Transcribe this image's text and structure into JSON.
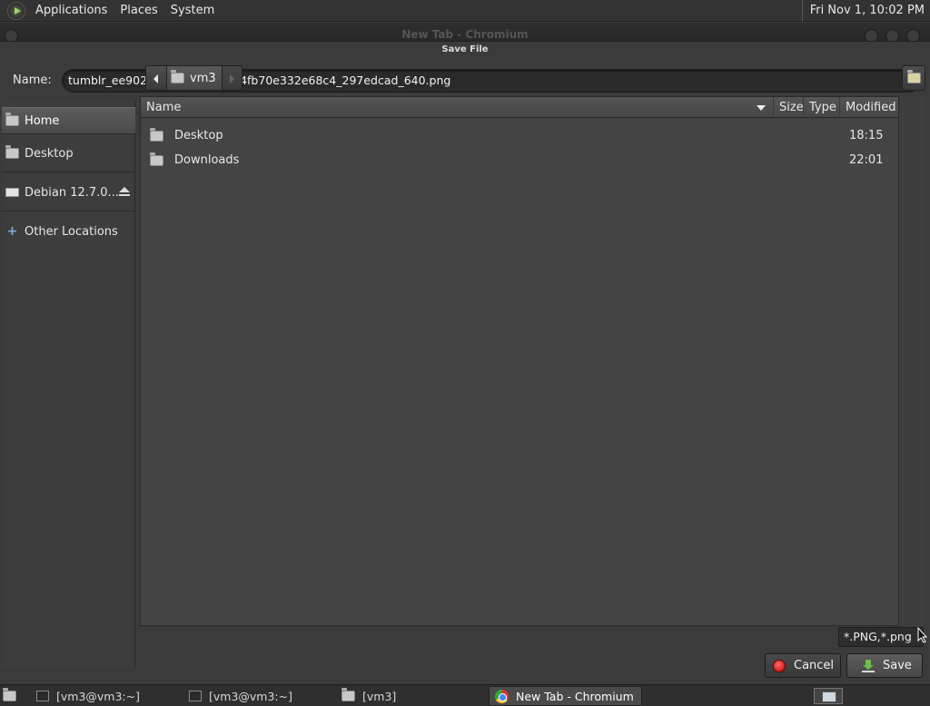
{
  "top_panel": {
    "menus": [
      "Applications",
      "Places",
      "System"
    ],
    "clock": "Fri Nov 1, 10:02 PM"
  },
  "window": {
    "title": "New Tab - Chromium"
  },
  "dialog": {
    "title": "Save File",
    "name_label": "Name:",
    "filename": "tumblr_ee902c51594277e1544fb70e332e68c4_297edcad_640.png",
    "sidebar": {
      "items": [
        {
          "label": "Home",
          "icon": "home-folder-icon",
          "active": true
        },
        {
          "label": "Desktop",
          "icon": "desktop-folder-icon",
          "active": false
        },
        {
          "label": "Debian 12.7.0...",
          "icon": "drive-icon",
          "active": false
        },
        {
          "label": "Other Locations",
          "icon": "plus-icon",
          "active": false
        }
      ]
    },
    "pathbar": {
      "current": "vm3"
    },
    "columns": {
      "name": "Name",
      "size": "Size",
      "type": "Type",
      "modified": "Modified"
    },
    "files": [
      {
        "name": "Desktop",
        "modified": "18:15"
      },
      {
        "name": "Downloads",
        "modified": "22:01"
      }
    ],
    "filter": "*.PNG,*.png",
    "cancel_label": "Cancel",
    "save_label": "Save"
  },
  "taskbar": {
    "tasks": [
      {
        "label": "[vm3@vm3:~]",
        "icon": "terminal-icon",
        "active": false
      },
      {
        "label": "[vm3@vm3:~]",
        "icon": "terminal-icon",
        "active": false
      },
      {
        "label": "[vm3]",
        "icon": "folder-icon",
        "active": false
      },
      {
        "label": "New Tab - Chromium",
        "icon": "chromium-icon",
        "active": true
      }
    ]
  },
  "colors": {
    "panel_bg": "#333333",
    "dialog_bg": "#3b3b3b",
    "list_bg": "#444444",
    "cancel_red": "#cc0000",
    "save_green": "#6cc04a"
  }
}
